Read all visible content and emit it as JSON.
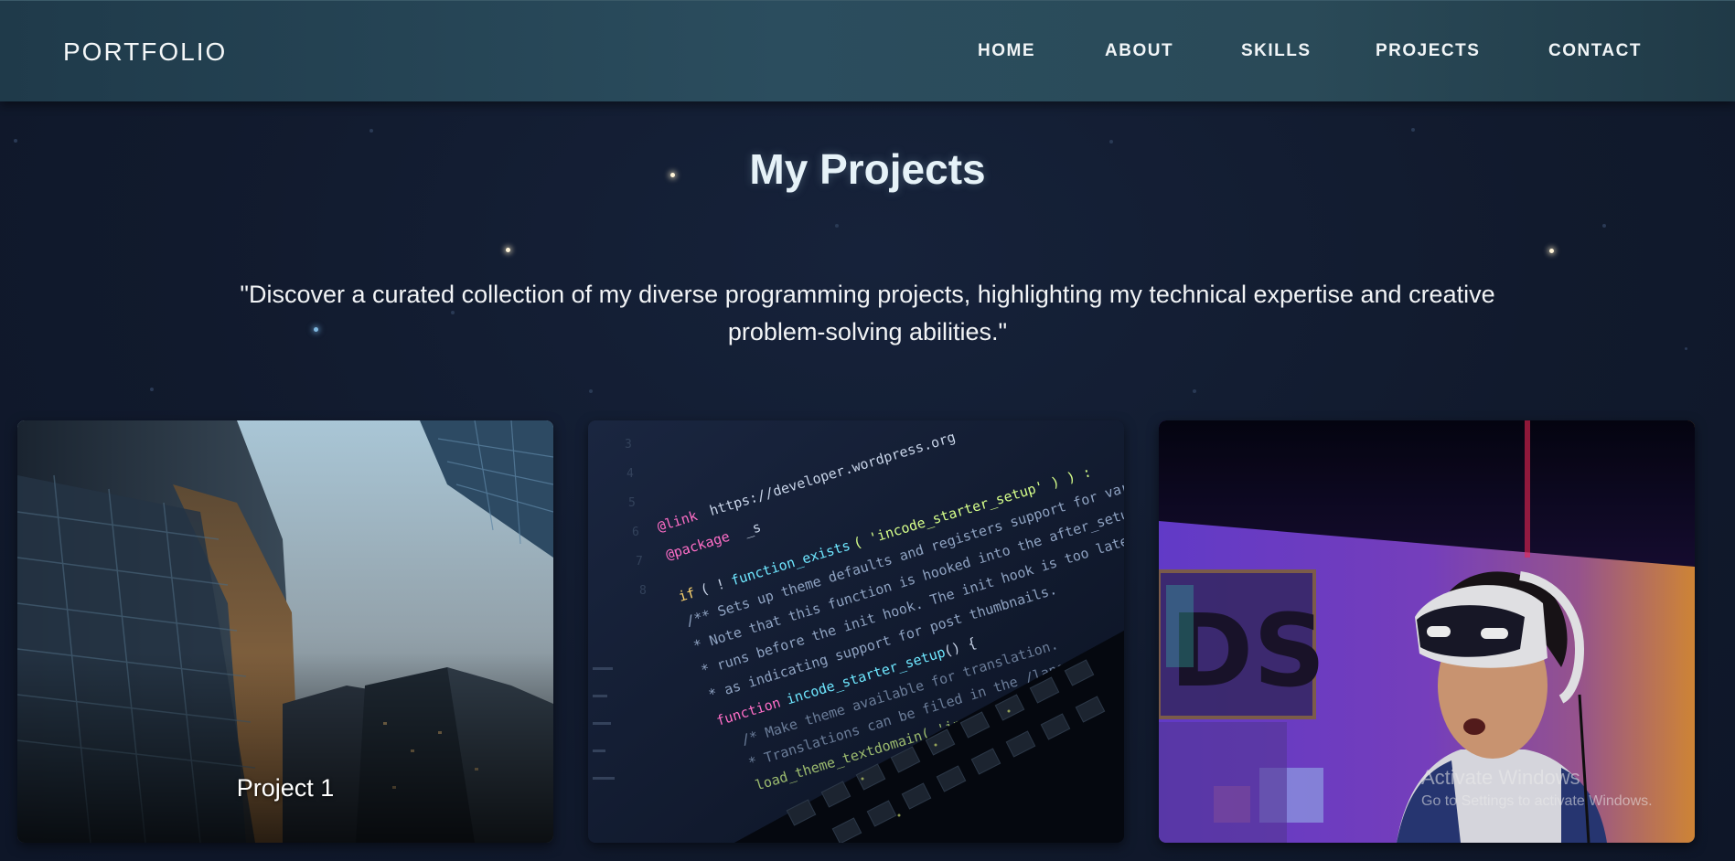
{
  "navbar": {
    "brand": "PORTFOLIO",
    "links": [
      "HOME",
      "ABOUT",
      "SKILLS",
      "PROJECTS",
      "CONTACT"
    ]
  },
  "section": {
    "title": "My Projects",
    "description": "\"Discover a curated collection of my diverse programming projects, highlighting my technical expertise and creative problem-solving abilities.\""
  },
  "projects": [
    {
      "label": "Project 1",
      "image_icon": "skyscrapers-photo"
    },
    {
      "label": "",
      "image_icon": "code-laptop-photo"
    },
    {
      "label": "",
      "image_icon": "vr-headset-photo"
    }
  ],
  "watermark": {
    "title": "Activate Windows",
    "subtitle": "Go to Settings to activate Windows."
  },
  "colors": {
    "background": "#101a2e",
    "navbar": "#2b4d5e",
    "title": "#e6f2f8"
  }
}
